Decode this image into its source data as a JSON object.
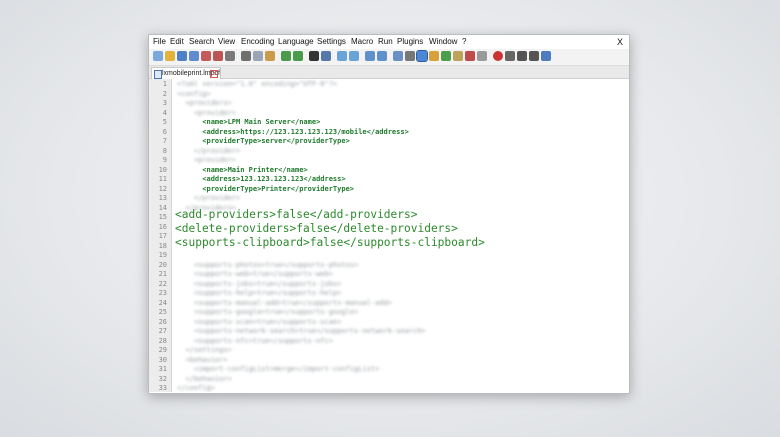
{
  "menu": [
    "File",
    "Edit",
    "Search",
    "View",
    "Encoding",
    "Language",
    "Settings",
    "Macro",
    "Run",
    "Plugins",
    "Window",
    "?"
  ],
  "close_label": "X",
  "tab": {
    "name": "lxmobileprint.lmpcf",
    "close_label": "x"
  },
  "line_numbers": [
    "1",
    "2",
    "3",
    "4",
    "5",
    "6",
    "7",
    "8",
    "9",
    "10",
    "11",
    "12",
    "13",
    "14",
    "15",
    "16",
    "17",
    "18",
    "19",
    "20",
    "21",
    "22",
    "23",
    "24",
    "25",
    "26",
    "27",
    "28",
    "29",
    "30",
    "31",
    "32",
    "33"
  ],
  "code": {
    "l1": "<?xml version=\"1.0\" encoding=\"UTF-8\"?>",
    "l2": "<config>",
    "l3": "  <providers>",
    "l4": "    <provider>",
    "l5": "      <name>LPM Main Server</name>",
    "l6": "      <address>https://123.123.123.123/mobile</address>",
    "l7": "      <providerType>server</providerType>",
    "l8": "    </provider>",
    "l9": "    <provider>",
    "l10": "      <name>Main Printer</name>",
    "l11": "      <address>123.123.123.123</address>",
    "l12": "      <providerType>Printer</providerType>",
    "l13": "    </provider>",
    "l14": "  </providers>",
    "l16": "<add-providers>false</add-providers>",
    "l17": "<delete-providers>false</delete-providers>",
    "l18": "<supports-clipboard>false</supports-clipboard>",
    "l20": "    <supports-photos>true</supports-photos>",
    "l21": "    <supports-web>true</supports-web>",
    "l22": "    <supports-jobs>true</supports-jobs>",
    "l23": "    <supports-help>true</supports-help>",
    "l24": "    <supports-manual-add>true</supports-manual-add>",
    "l25": "    <supports-google>true</supports-google>",
    "l26": "    <supports-scan>true</supports-scan>",
    "l27": "    <supports-network-search>true</supports-network-search>",
    "l28": "    <supports-nfc>true</supports-nfc>",
    "l29": "  </settings>",
    "l30": "  <behavior>",
    "l31": "    <import-configList>merge</import-configList>",
    "l32": "  </behavior>",
    "l33": "</config>"
  },
  "colors": {
    "tag_green": "#1f7a2d",
    "highlight_green": "#2c8a2c",
    "gutter": "#ececec"
  }
}
